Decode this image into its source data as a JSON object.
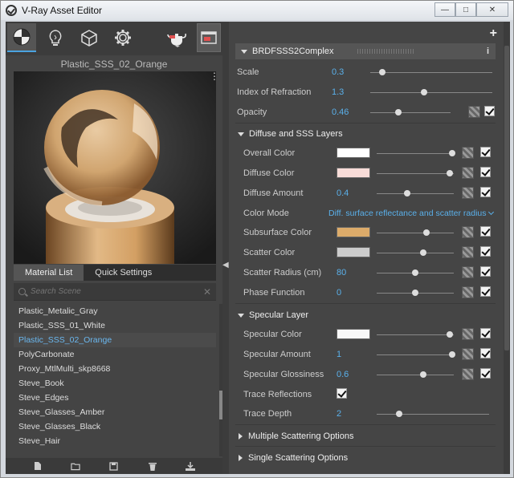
{
  "window": {
    "title": "V-Ray Asset Editor",
    "minimize_glyph": "—",
    "maximize_glyph": "□",
    "close_glyph": "✕"
  },
  "toolbar": {
    "icons": [
      "materials-icon",
      "lights-icon",
      "geometry-icon",
      "settings-icon",
      "render-teapot-icon",
      "render-window-icon"
    ]
  },
  "preview": {
    "material_name": "Plastic_SSS_02_Orange",
    "menu_glyph": "⋮"
  },
  "tabs": [
    {
      "label": "Material List"
    },
    {
      "label": "Quick Settings"
    }
  ],
  "search": {
    "placeholder": "Search Scene",
    "clear_glyph": "✕"
  },
  "materials": [
    "Plastic_Metalic_Gray",
    "Plastic_SSS_01_White",
    "Plastic_SSS_02_Orange",
    "PolyCarbonate",
    "Proxy_MtlMulti_skp8668",
    "Steve_Book",
    "Steve_Edges",
    "Steve_Glasses_Amber",
    "Steve_Glasses_Black",
    "Steve_Hair"
  ],
  "selected_material": "Plastic_SSS_02_Orange",
  "bottom_icons": [
    "new-file-icon",
    "open-folder-icon",
    "save-icon",
    "delete-icon",
    "import-icon"
  ],
  "right": {
    "add_glyph": "+",
    "brdf_header": "BRDFSSS2Complex",
    "info_glyph": "i",
    "top_params": [
      {
        "label": "Scale",
        "value": "0.3",
        "slider": 0.1
      },
      {
        "label": "Index of Refraction",
        "value": "1.3",
        "slider": 0.44
      },
      {
        "label": "Opacity",
        "value": "0.46",
        "slider": 0.35
      }
    ],
    "diffuse_section": "Diffuse and SSS Layers",
    "overall_color": {
      "label": "Overall Color",
      "color": "#ffffff",
      "slider": 0.98
    },
    "diffuse_color": {
      "label": "Diffuse Color",
      "color": "#f8dcd8",
      "slider": 0.95
    },
    "diffuse_amount": {
      "label": "Diffuse Amount",
      "value": "0.4",
      "slider": 0.4
    },
    "color_mode": {
      "label": "Color Mode",
      "value": "Diff. surface reflectance and scatter radius"
    },
    "subsurface_color": {
      "label": "Subsurface Color",
      "color": "#dcab6a",
      "slider": 0.65
    },
    "scatter_color": {
      "label": "Scatter Color",
      "color": "#cccccc",
      "slider": 0.6
    },
    "scatter_radius": {
      "label": "Scatter Radius (cm)",
      "value": "80",
      "slider": 0.5
    },
    "phase_function": {
      "label": "Phase Function",
      "value": "0",
      "slider": 0.5
    },
    "specular_section": "Specular Layer",
    "specular_color": {
      "label": "Specular Color",
      "color": "#f8f8f8",
      "slider": 0.95
    },
    "specular_amount": {
      "label": "Specular Amount",
      "value": "1",
      "slider": 0.98
    },
    "specular_glossiness": {
      "label": "Specular Glossiness",
      "value": "0.6",
      "slider": 0.6
    },
    "trace_reflections": {
      "label": "Trace Reflections",
      "checked": true
    },
    "trace_depth": {
      "label": "Trace Depth",
      "value": "2",
      "slider": 0.2
    },
    "multiple_scattering": "Multiple Scattering Options",
    "single_scattering": "Single Scattering Options"
  },
  "colors": {
    "accent": "#5ab0ea",
    "selected_list_text": "#6ab7ee"
  }
}
